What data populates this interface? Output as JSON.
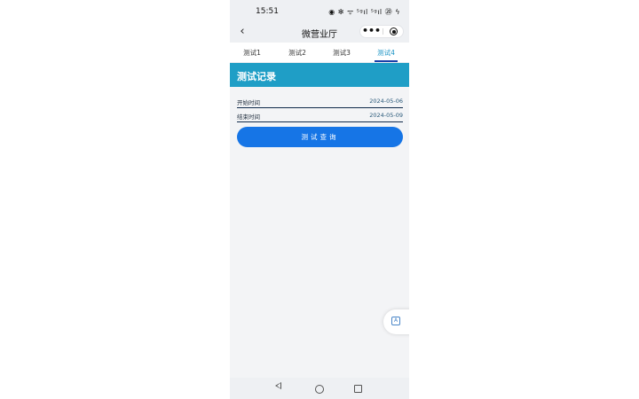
{
  "status_bar": {
    "time": "15:51",
    "icons_text": "◉ ✻ ᯤ ⁵ᵍıl ⁵ᵍıl ⑳ ϟ",
    "icons": [
      "eye-icon",
      "bluetooth-icon",
      "wifi-icon",
      "signal-5g-icon",
      "signal-5g-icon",
      "battery-icon",
      "charging-icon"
    ]
  },
  "nav": {
    "title": "微营业厅",
    "back_glyph": "‹",
    "more_glyph": "•••"
  },
  "tabs": [
    {
      "label": "测试1",
      "active": false
    },
    {
      "label": "测试2",
      "active": false
    },
    {
      "label": "测试3",
      "active": false
    },
    {
      "label": "测试4",
      "active": true
    }
  ],
  "banner": {
    "title": "测试记录"
  },
  "form": {
    "start": {
      "label": "开始时间",
      "value": "2024-05-06"
    },
    "end": {
      "label": "结束时间",
      "value": "2024-05-09"
    }
  },
  "query_button": "测试查询",
  "colors": {
    "accent": "#1f9ec6",
    "button": "#1675e6",
    "active_tab": "#1a93c4",
    "tab_underline": "#1a3fa8",
    "background": "#f3f4f6"
  },
  "fab": {
    "icon": "scan-text-icon",
    "glyph": "A"
  }
}
